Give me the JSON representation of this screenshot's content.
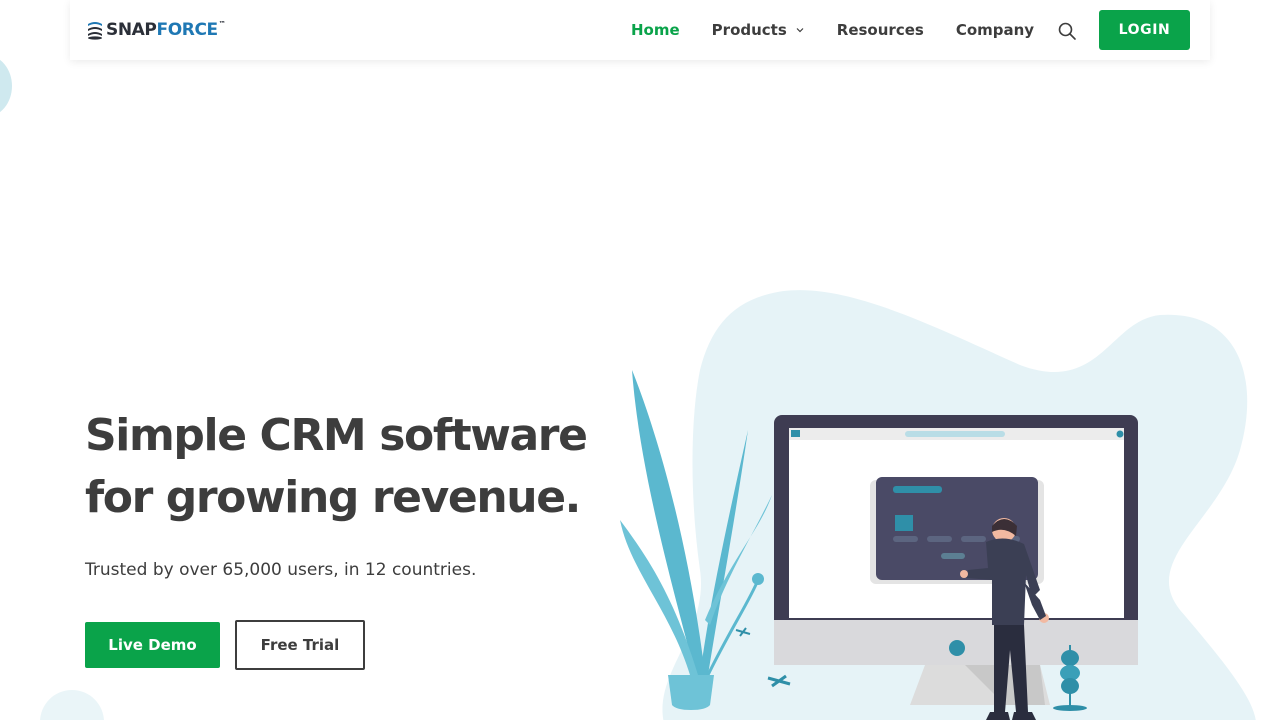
{
  "header": {
    "logo": {
      "snap": "SNAP",
      "force": "FORCE",
      "tm": "™"
    },
    "nav": [
      {
        "label": "Home",
        "active": true
      },
      {
        "label": "Products",
        "has_dropdown": true
      },
      {
        "label": "Resources"
      },
      {
        "label": "Company"
      }
    ],
    "search_icon": "search-icon",
    "login_label": "LOGIN"
  },
  "hero": {
    "headline": "Simple CRM software for growing revenue.",
    "subtitle": "Trusted by over 65,000 users, in 12 countries.",
    "buttons": {
      "demo_label": "Live Demo",
      "trial_label": "Free Trial"
    },
    "illustration": "person-at-monitor-with-plant-illustration"
  },
  "colors": {
    "brand_green": "#0aa34a",
    "text_dark": "#3d3d3d",
    "logo_blue": "#1f78b4",
    "blob_light": "#e6f3f7",
    "leaf_teal": "#5bb8cf",
    "monitor_dark": "#3e3c52"
  }
}
